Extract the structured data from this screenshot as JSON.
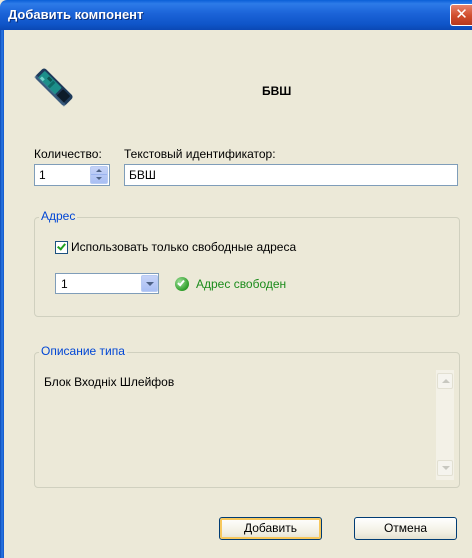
{
  "window": {
    "title": "Добавить компонент",
    "close_glyph": "✕"
  },
  "component": {
    "icon": "device-board-icon",
    "name": "БВШ"
  },
  "quantity": {
    "label": "Количество:",
    "value": "1"
  },
  "identifier": {
    "label": "Текстовый идентификатор:",
    "value": "БВШ"
  },
  "address": {
    "group_label": "Адрес",
    "only_free_label": "Использовать только свободные адреса",
    "only_free_checked": true,
    "selected_address": "1",
    "status_text": "Адрес свободен",
    "status_icon": "ok-check-icon"
  },
  "description": {
    "group_label": "Описание типа",
    "text": "Блок Входнiх Шлейфов"
  },
  "buttons": {
    "add": "Добавить",
    "cancel": "Отмена"
  },
  "colors": {
    "titlebar": "#0b55c9",
    "group_label": "#0046d5",
    "status_ok": "#1c8c1c",
    "dialog_bg": "#ece9d8"
  }
}
